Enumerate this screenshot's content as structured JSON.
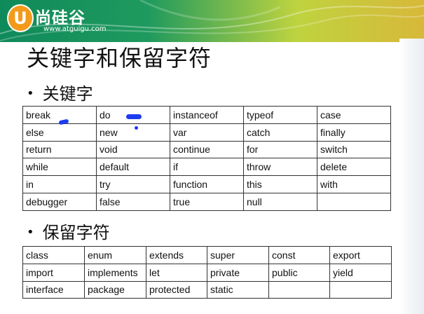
{
  "brand": {
    "logo_letter": "U",
    "name": "尚硅谷",
    "url": "www.atguigu.com"
  },
  "slide": {
    "title": "关键字和保留字符",
    "keywords_heading": "关键字",
    "reserved_heading": "保留字符"
  },
  "keywords_table": [
    [
      "break",
      "do",
      "instanceof",
      "typeof",
      "case"
    ],
    [
      "else",
      "new",
      "var",
      "catch",
      "finally"
    ],
    [
      "return",
      "void",
      "continue",
      "for",
      "switch"
    ],
    [
      "while",
      "default",
      "if",
      "throw",
      "delete"
    ],
    [
      "in",
      "try",
      "function",
      "this",
      "with"
    ],
    [
      "debugger",
      "false",
      "true",
      "null",
      ""
    ]
  ],
  "reserved_table": [
    [
      "class",
      "enum",
      "extends",
      "super",
      "const",
      "export"
    ],
    [
      "import",
      "implements",
      "let",
      "private",
      "public",
      "yield"
    ],
    [
      "interface",
      "package",
      "protected",
      "static",
      "",
      ""
    ]
  ],
  "colors": {
    "header_start": "#0f8a5a",
    "header_end": "#d8b83a",
    "logo_orange": "#f39a1b",
    "ink_marks": "#1d3cf0"
  }
}
